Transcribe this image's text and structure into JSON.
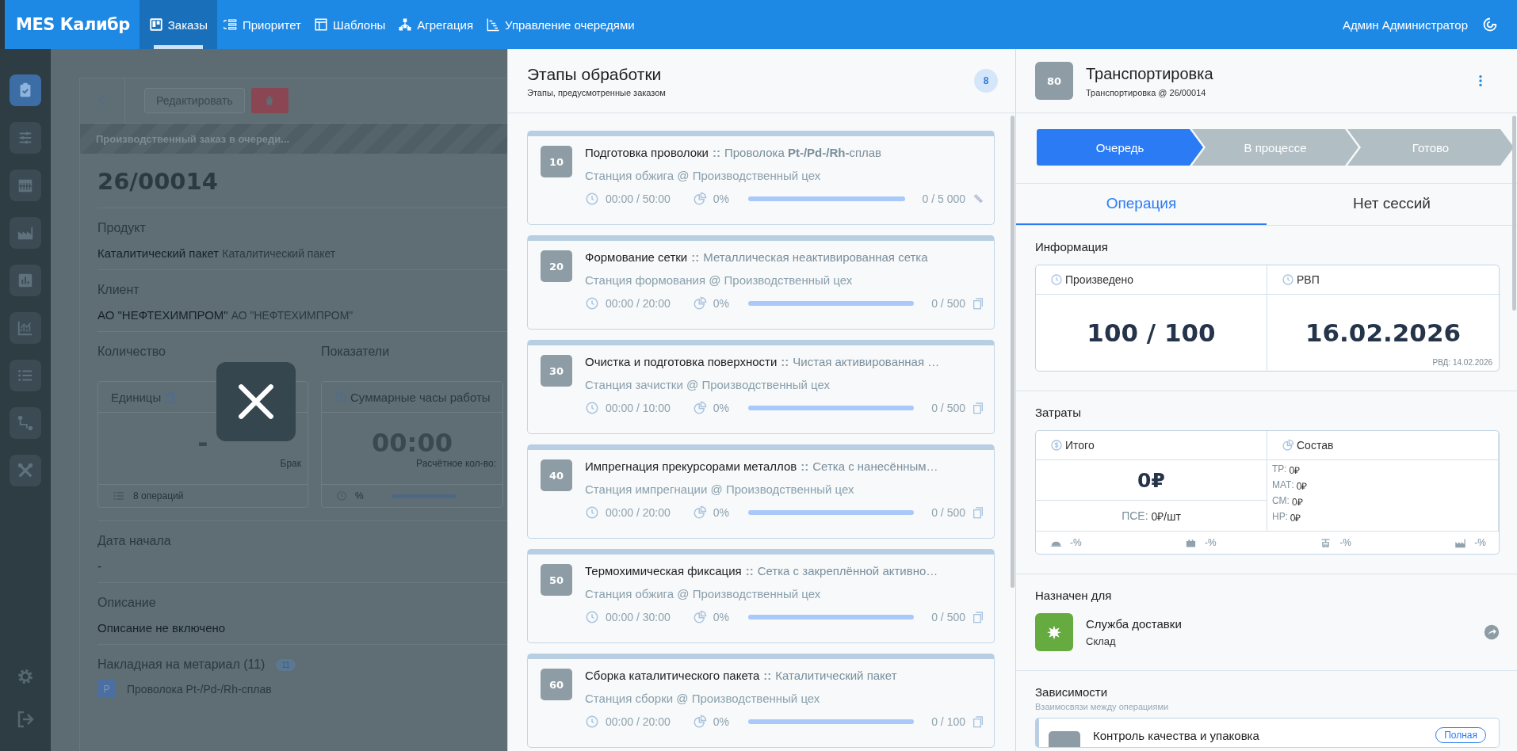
{
  "topbar": {
    "logo": "MES Калибр",
    "nav": [
      {
        "kind": "board",
        "label": "Заказы",
        "selected": true
      },
      {
        "kind": "priority",
        "label": "Приоритет",
        "selected": false
      },
      {
        "kind": "templates",
        "label": "Шаблоны",
        "selected": false
      },
      {
        "kind": "aggregation",
        "label": "Агрегация",
        "selected": false
      },
      {
        "kind": "queues",
        "label": "Управление очередями",
        "selected": false
      }
    ],
    "user": "Админ Администратор"
  },
  "sidebar": {
    "items": [
      {
        "kind": "clipboard",
        "selected": true
      },
      {
        "kind": "sliders",
        "selected": false
      },
      {
        "kind": "calendar",
        "selected": false
      },
      {
        "kind": "factory",
        "selected": false
      },
      {
        "kind": "barchart",
        "selected": false
      },
      {
        "kind": "linechart",
        "selected": false
      },
      {
        "kind": "list",
        "selected": false
      },
      {
        "kind": "route",
        "selected": false
      },
      {
        "kind": "tools",
        "selected": false
      }
    ],
    "bottom_items": [
      {
        "kind": "settings"
      },
      {
        "kind": "logout"
      }
    ]
  },
  "order": {
    "edit_button": "Редактировать",
    "status_banner": "Производственный заказ в очереди...",
    "number": "26/00014",
    "fields": [
      {
        "label": "Продукт",
        "value": "Каталитический пакет",
        "secondary": "Каталитический пакет"
      },
      {
        "label": "Клиент",
        "value": "АО \"НЕФТЕХИМПРОМ\"",
        "secondary": "АО \"НЕФТЕХИМПРОМ\""
      }
    ],
    "quantity": {
      "heading": "Количество",
      "card_title": "Единицы",
      "value": "-",
      "note": "Брак",
      "footer": "8 операций"
    },
    "metrics": {
      "heading": "Показатели",
      "card_title": "Суммарные часы работы",
      "value": "00:00",
      "note": "Расчётное кол-во:",
      "footer": "%",
      "level": 0
    },
    "start_date": {
      "label": "Дата начала",
      "value": "-"
    },
    "description": {
      "label": "Описание",
      "value": "Описание не включено"
    },
    "materials": {
      "title": "Накладная на метариал (11)",
      "count": "11",
      "items": [
        {
          "badge": "P",
          "name": "Проволока Pt-/Pd-/Rh-сплав"
        }
      ]
    }
  },
  "stages": {
    "title": "Этапы обработки",
    "subtitle": "Этапы, предусмотренные заказом",
    "count": "8",
    "items": [
      {
        "number": "10",
        "title": "Подготовка проволоки",
        "separator": "::",
        "product": "Проволока **Pt-/Pd-/Rh-**сплав",
        "station": "Станция обжига @ Производственный цех",
        "time": "00:00 / 50:00",
        "percent": "0%",
        "level": 0,
        "quantity": "0 / 5 000",
        "kind": "length"
      },
      {
        "number": "20",
        "title": "Формование сетки",
        "separator": "::",
        "product": "Металлическая неактивированная сетка",
        "station": "Станция формования @ Производственный цех",
        "time": "00:00 / 20:00",
        "percent": "0%",
        "level": 0,
        "quantity": "0 / 500",
        "kind": "pieces"
      },
      {
        "number": "30",
        "title": "Очистка и подготовка поверхности",
        "separator": "::",
        "product": "Чистая активированная …",
        "station": "Станция зачистки @ Производственный цех",
        "time": "00:00 / 10:00",
        "percent": "0%",
        "level": 0,
        "quantity": "0 / 500",
        "kind": "pieces"
      },
      {
        "number": "40",
        "title": "Импрегнация прекурсорами металлов",
        "separator": "::",
        "product": "Сетка с нанесённым…",
        "station": "Станция импрегнации @ Производственный цех",
        "time": "00:00 / 20:00",
        "percent": "0%",
        "level": 0,
        "quantity": "0 / 500",
        "kind": "pieces"
      },
      {
        "number": "50",
        "title": "Термохимическая фиксация",
        "separator": "::",
        "product": "Сетка с закреплённой активно…",
        "station": "Станция обжига @ Производственный цех",
        "time": "00:00 / 30:00",
        "percent": "0%",
        "level": 0,
        "quantity": "0 / 500",
        "kind": "pieces"
      },
      {
        "number": "60",
        "title": "Сборка каталитического пакета",
        "separator": "::",
        "product": "Каталитический пакет",
        "station": "Станция сборки @ Производственный цех",
        "time": "00:00 / 20:00",
        "percent": "0%",
        "level": 0,
        "quantity": "0 / 100",
        "kind": "pieces"
      }
    ]
  },
  "operation": {
    "number": "80",
    "title": "Транспортировка",
    "subtitle": "Транспортировка @ 26/00014",
    "steps": [
      {
        "label": "Очередь",
        "selected": true
      },
      {
        "label": "В процессе",
        "selected": false
      },
      {
        "label": "Готово",
        "selected": false
      }
    ],
    "tabs": [
      {
        "label": "Операция",
        "selected": true
      },
      {
        "label": "Нет сессий",
        "selected": false
      }
    ],
    "info": {
      "heading": "Информация",
      "produced": {
        "label": "Произведено",
        "value": "100 / 100"
      },
      "due": {
        "label": "РВП",
        "value": "16.02.2026",
        "note": "РВД: 14.02.2026"
      }
    },
    "costs": {
      "heading": "Затраты",
      "total": {
        "label": "Итого",
        "value": "0₽",
        "unit_label": "ПСЕ:",
        "unit_value": "0₽/шт"
      },
      "composition": {
        "label": "Состав",
        "items": [
          {
            "label": "ТР:",
            "value": "0₽"
          },
          {
            "label": "МАТ:",
            "value": "0₽"
          },
          {
            "label": "СМ:",
            "value": "0₽"
          },
          {
            "label": "НР:",
            "value": "0₽"
          }
        ]
      },
      "shares": [
        {
          "kind": "labor",
          "value": "-%"
        },
        {
          "kind": "material",
          "value": "-%"
        },
        {
          "kind": "machine",
          "value": "-%"
        },
        {
          "kind": "overhead",
          "value": "-%"
        }
      ]
    },
    "assigned": {
      "heading": "Назначен для",
      "name": "Служба доставки",
      "role": "Склад"
    },
    "dependencies": {
      "heading": "Зависимости",
      "subtitle": "Взаимосвязи между операциями",
      "items": [
        {
          "name": "Контроль качества и упаковка",
          "badge": "Полная"
        }
      ]
    }
  }
}
